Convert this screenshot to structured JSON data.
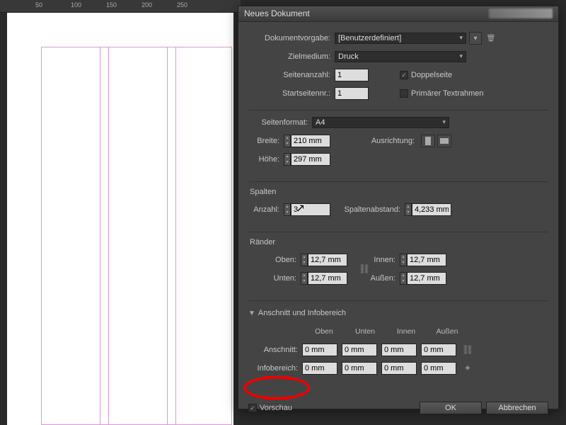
{
  "ruler": {
    "marks": [
      50,
      100,
      150,
      200,
      250
    ]
  },
  "dialog": {
    "title": "Neues Dokument",
    "preset_lbl": "Dokumentvorgabe:",
    "preset_val": "[Benutzerdefiniert]",
    "intent_lbl": "Zielmedium:",
    "intent_val": "Druck",
    "pages_lbl": "Seitenanzahl:",
    "pages_val": "1",
    "facing_lbl": "Doppelseite",
    "startpage_lbl": "Startseitennr.:",
    "startpage_val": "1",
    "primarytext_lbl": "Primärer Textrahmen",
    "pagesize_lbl": "Seitenformat:",
    "pagesize_val": "A4",
    "width_lbl": "Breite:",
    "width_val": "210 mm",
    "height_lbl": "Höhe:",
    "height_val": "297 mm",
    "orient_lbl": "Ausrichtung:",
    "columns_section": "Spalten",
    "colcount_lbl": "Anzahl:",
    "colcount_val": "3",
    "gutter_lbl": "Spaltenabstand:",
    "gutter_val": "4,233 mm",
    "margins_section": "Ränder",
    "top_lbl": "Oben:",
    "bottom_lbl": "Unten:",
    "inner_lbl": "Innen:",
    "outer_lbl": "Außen:",
    "margin_top": "12,7 mm",
    "margin_bottom": "12,7 mm",
    "margin_inner": "12,7 mm",
    "margin_outer": "12,7 mm",
    "bleed_section": "Anschnitt und Infobereich",
    "hdr_top": "Oben",
    "hdr_bottom": "Unten",
    "hdr_inner": "Innen",
    "hdr_outer": "Außen",
    "bleed_lbl": "Anschnitt:",
    "slug_lbl": "Infobereich:",
    "bleed_top": "0 mm",
    "bleed_bottom": "0 mm",
    "bleed_inner": "0 mm",
    "bleed_outer": "0 mm",
    "slug_top": "0 mm",
    "slug_bottom": "0 mm",
    "slug_inner": "0 mm",
    "slug_outer": "0 mm",
    "preview_lbl": "Vorschau",
    "ok_lbl": "OK",
    "cancel_lbl": "Abbrechen"
  }
}
